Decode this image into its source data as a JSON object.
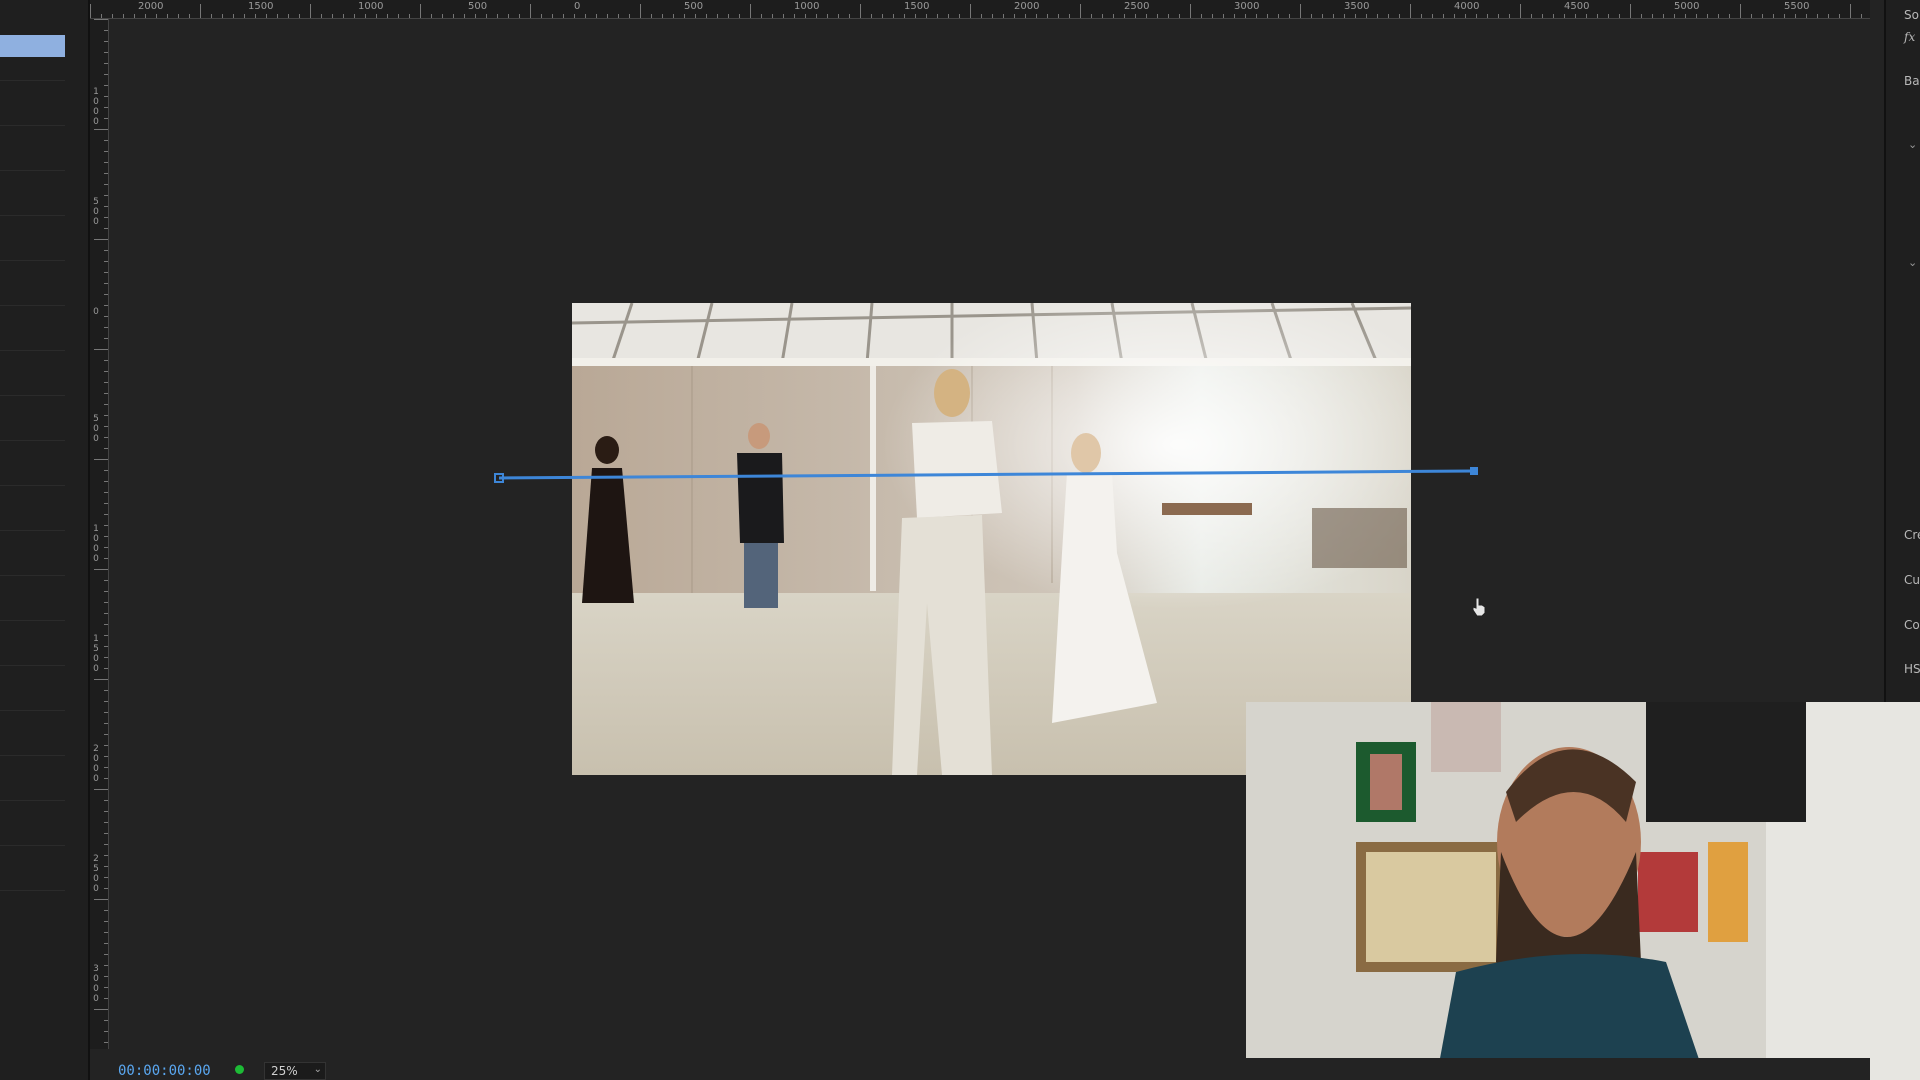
{
  "rulers": {
    "top_labels": [
      "2000",
      "1500",
      "1000",
      "500",
      "0",
      "500",
      "1000",
      "1500",
      "2000",
      "2500",
      "3000",
      "3500",
      "4000",
      "4500",
      "5000",
      "5500"
    ],
    "left_labels": [
      "1000",
      "500",
      "0",
      "500",
      "1000",
      "1500",
      "2000",
      "2500",
      "3000"
    ]
  },
  "right_panel": {
    "items": [
      "Sou",
      "fx",
      "Bas",
      "Cre",
      "Cur",
      "Col",
      "HSl"
    ]
  },
  "bottom_bar": {
    "timecode": "00:00:00:00",
    "zoom": "25%"
  },
  "colors": {
    "accent_blue": "#3d86d8",
    "timecode_blue": "#5aa7f0",
    "status_green": "#1dbb36",
    "selection_blue": "#8fb0e0"
  },
  "icons": {
    "cursor": "hand-pointer-icon",
    "zoom_dropdown": "chevron-down-icon"
  }
}
